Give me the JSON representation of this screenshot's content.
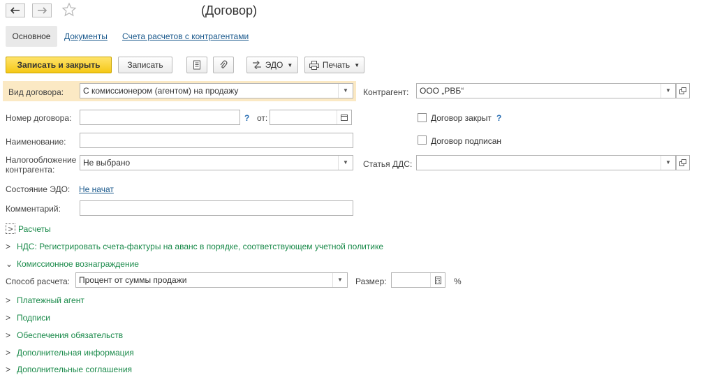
{
  "window": {
    "title": "(Договор)"
  },
  "tabs": [
    {
      "label": "Основное",
      "active": true
    },
    {
      "label": "Документы"
    },
    {
      "label": "Счета расчетов с контрагентами"
    }
  ],
  "toolbar": {
    "save_close": "Записать и закрыть",
    "save": "Записать",
    "edo": "ЭДО",
    "print": "Печать"
  },
  "form": {
    "contract_type": {
      "label": "Вид договора:",
      "value": "С комиссионером (агентом) на продажу"
    },
    "counterparty": {
      "label": "Контрагент:",
      "value": "ООО „РВБ“"
    },
    "number": {
      "label": "Номер договора:",
      "value": "",
      "help": "?",
      "from_label": "от:",
      "date": ""
    },
    "closed": {
      "label": "Договор закрыт",
      "help": "?",
      "checked": false
    },
    "name": {
      "label": "Наименование:",
      "value": ""
    },
    "signed": {
      "label": "Договор подписан",
      "checked": false
    },
    "tax": {
      "label1": "Налогообложение",
      "label2": "контрагента:",
      "value": "Не выбрано"
    },
    "dds": {
      "label": "Статья ДДС:",
      "value": ""
    },
    "edo_state": {
      "label": "Состояние ЭДО:",
      "value": "Не начат"
    },
    "comment": {
      "label": "Комментарий:",
      "value": ""
    }
  },
  "sections": {
    "payments": "Расчеты",
    "vat": "НДС: Регистрировать счета-фактуры на аванс в порядке, соответствующем учетной политике",
    "commission": "Комиссионное вознаграждение",
    "payment_agent": "Платежный агент",
    "signatures": "Подписи",
    "obligations": "Обеспечения обязательств",
    "additional_info": "Дополнительная информация",
    "additional_agreements": "Дополнительные соглашения"
  },
  "commission_fields": {
    "method_label": "Способ расчета:",
    "method_value": "Процент от суммы продажи",
    "size_label": "Размер:",
    "size_value": "",
    "percent": "%"
  },
  "colors": {
    "highlight_row": "#fbe9c4",
    "section_green": "#1a8a4a",
    "primary_button": "#f5c816"
  }
}
